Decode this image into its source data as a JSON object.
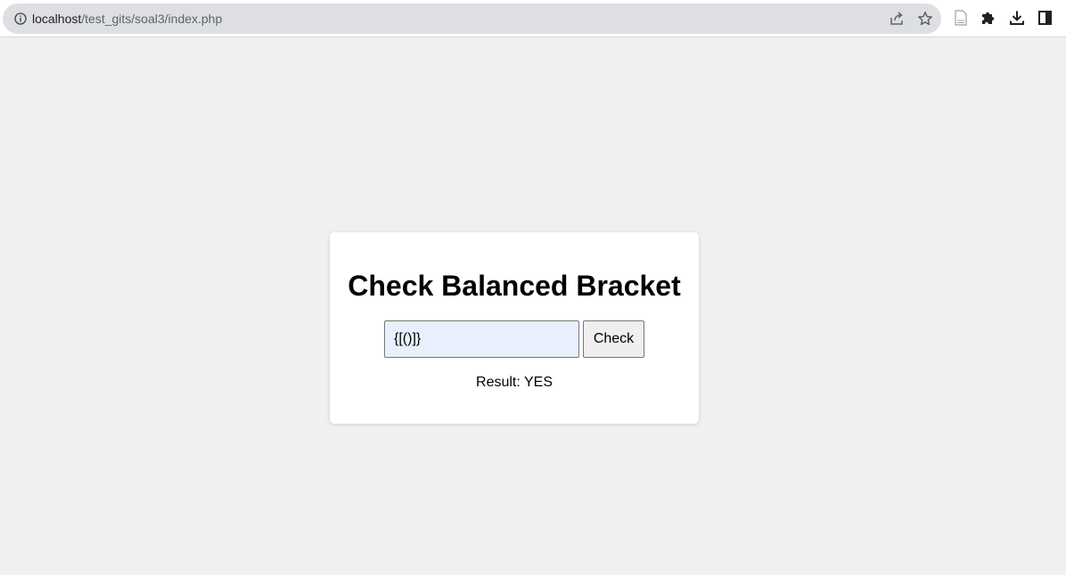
{
  "browser": {
    "url_host": "localhost",
    "url_path": "/test_gits/soal3/index.php"
  },
  "icons": [
    "info-icon",
    "share-icon",
    "star-icon",
    "page-icon",
    "extensions-icon",
    "download-icon",
    "side-panel-icon"
  ],
  "page": {
    "title": "Check Balanced Bracket",
    "input_value": "{[()]}",
    "check_label": "Check",
    "result_text": "Result: YES"
  },
  "colors": {
    "page_background": "#f0f0f0",
    "card_background": "#ffffff",
    "input_background": "#e8f0fe"
  }
}
